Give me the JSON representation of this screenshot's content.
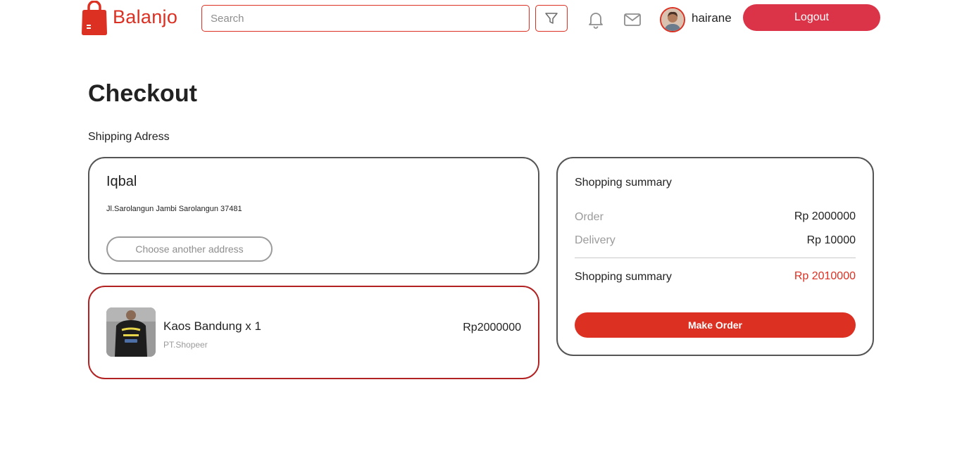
{
  "header": {
    "brand": "Balanjo",
    "search_placeholder": "Search",
    "username": "hairane",
    "logout_label": "Logout"
  },
  "page": {
    "title": "Checkout",
    "shipping_label": "Shipping Adress"
  },
  "address": {
    "name": "Iqbal",
    "line": "Jl.Sarolangun Jambi Sarolangun 37481",
    "choose_label": "Choose another address"
  },
  "product": {
    "name": "Kaos Bandung x 1",
    "seller": "PT.Shopeer",
    "price": "Rp2000000"
  },
  "summary": {
    "title": "Shopping summary",
    "order_label": "Order",
    "order_value": "Rp 2000000",
    "delivery_label": "Delivery",
    "delivery_value": "Rp 10000",
    "total_label": "Shopping summary",
    "total_value": "Rp 2010000",
    "make_order_label": "Make Order"
  },
  "colors": {
    "brand": "#DB3022",
    "logout": "#DB3347",
    "product_border": "#B22222"
  },
  "icons": [
    "shopping-bag-logo",
    "filter-icon",
    "bell-icon",
    "mail-icon",
    "avatar"
  ]
}
